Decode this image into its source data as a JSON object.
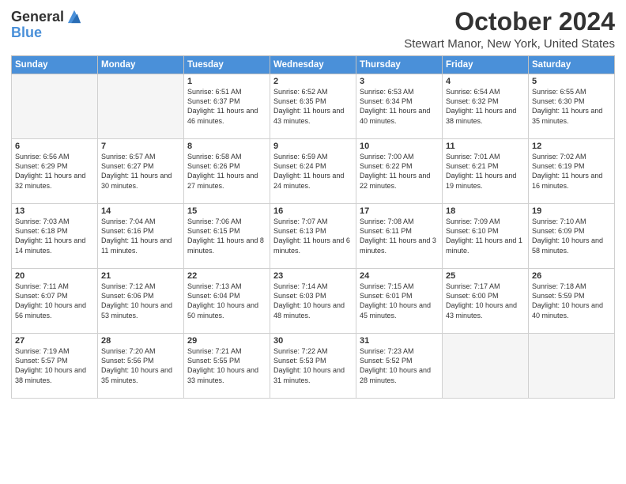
{
  "header": {
    "logo_general": "General",
    "logo_blue": "Blue",
    "month": "October 2024",
    "location": "Stewart Manor, New York, United States"
  },
  "days_of_week": [
    "Sunday",
    "Monday",
    "Tuesday",
    "Wednesday",
    "Thursday",
    "Friday",
    "Saturday"
  ],
  "weeks": [
    [
      {
        "day": "",
        "empty": true
      },
      {
        "day": "",
        "empty": true
      },
      {
        "day": "1",
        "sunrise": "Sunrise: 6:51 AM",
        "sunset": "Sunset: 6:37 PM",
        "daylight": "Daylight: 11 hours and 46 minutes."
      },
      {
        "day": "2",
        "sunrise": "Sunrise: 6:52 AM",
        "sunset": "Sunset: 6:35 PM",
        "daylight": "Daylight: 11 hours and 43 minutes."
      },
      {
        "day": "3",
        "sunrise": "Sunrise: 6:53 AM",
        "sunset": "Sunset: 6:34 PM",
        "daylight": "Daylight: 11 hours and 40 minutes."
      },
      {
        "day": "4",
        "sunrise": "Sunrise: 6:54 AM",
        "sunset": "Sunset: 6:32 PM",
        "daylight": "Daylight: 11 hours and 38 minutes."
      },
      {
        "day": "5",
        "sunrise": "Sunrise: 6:55 AM",
        "sunset": "Sunset: 6:30 PM",
        "daylight": "Daylight: 11 hours and 35 minutes."
      }
    ],
    [
      {
        "day": "6",
        "sunrise": "Sunrise: 6:56 AM",
        "sunset": "Sunset: 6:29 PM",
        "daylight": "Daylight: 11 hours and 32 minutes."
      },
      {
        "day": "7",
        "sunrise": "Sunrise: 6:57 AM",
        "sunset": "Sunset: 6:27 PM",
        "daylight": "Daylight: 11 hours and 30 minutes."
      },
      {
        "day": "8",
        "sunrise": "Sunrise: 6:58 AM",
        "sunset": "Sunset: 6:26 PM",
        "daylight": "Daylight: 11 hours and 27 minutes."
      },
      {
        "day": "9",
        "sunrise": "Sunrise: 6:59 AM",
        "sunset": "Sunset: 6:24 PM",
        "daylight": "Daylight: 11 hours and 24 minutes."
      },
      {
        "day": "10",
        "sunrise": "Sunrise: 7:00 AM",
        "sunset": "Sunset: 6:22 PM",
        "daylight": "Daylight: 11 hours and 22 minutes."
      },
      {
        "day": "11",
        "sunrise": "Sunrise: 7:01 AM",
        "sunset": "Sunset: 6:21 PM",
        "daylight": "Daylight: 11 hours and 19 minutes."
      },
      {
        "day": "12",
        "sunrise": "Sunrise: 7:02 AM",
        "sunset": "Sunset: 6:19 PM",
        "daylight": "Daylight: 11 hours and 16 minutes."
      }
    ],
    [
      {
        "day": "13",
        "sunrise": "Sunrise: 7:03 AM",
        "sunset": "Sunset: 6:18 PM",
        "daylight": "Daylight: 11 hours and 14 minutes."
      },
      {
        "day": "14",
        "sunrise": "Sunrise: 7:04 AM",
        "sunset": "Sunset: 6:16 PM",
        "daylight": "Daylight: 11 hours and 11 minutes."
      },
      {
        "day": "15",
        "sunrise": "Sunrise: 7:06 AM",
        "sunset": "Sunset: 6:15 PM",
        "daylight": "Daylight: 11 hours and 8 minutes."
      },
      {
        "day": "16",
        "sunrise": "Sunrise: 7:07 AM",
        "sunset": "Sunset: 6:13 PM",
        "daylight": "Daylight: 11 hours and 6 minutes."
      },
      {
        "day": "17",
        "sunrise": "Sunrise: 7:08 AM",
        "sunset": "Sunset: 6:11 PM",
        "daylight": "Daylight: 11 hours and 3 minutes."
      },
      {
        "day": "18",
        "sunrise": "Sunrise: 7:09 AM",
        "sunset": "Sunset: 6:10 PM",
        "daylight": "Daylight: 11 hours and 1 minute."
      },
      {
        "day": "19",
        "sunrise": "Sunrise: 7:10 AM",
        "sunset": "Sunset: 6:09 PM",
        "daylight": "Daylight: 10 hours and 58 minutes."
      }
    ],
    [
      {
        "day": "20",
        "sunrise": "Sunrise: 7:11 AM",
        "sunset": "Sunset: 6:07 PM",
        "daylight": "Daylight: 10 hours and 56 minutes."
      },
      {
        "day": "21",
        "sunrise": "Sunrise: 7:12 AM",
        "sunset": "Sunset: 6:06 PM",
        "daylight": "Daylight: 10 hours and 53 minutes."
      },
      {
        "day": "22",
        "sunrise": "Sunrise: 7:13 AM",
        "sunset": "Sunset: 6:04 PM",
        "daylight": "Daylight: 10 hours and 50 minutes."
      },
      {
        "day": "23",
        "sunrise": "Sunrise: 7:14 AM",
        "sunset": "Sunset: 6:03 PM",
        "daylight": "Daylight: 10 hours and 48 minutes."
      },
      {
        "day": "24",
        "sunrise": "Sunrise: 7:15 AM",
        "sunset": "Sunset: 6:01 PM",
        "daylight": "Daylight: 10 hours and 45 minutes."
      },
      {
        "day": "25",
        "sunrise": "Sunrise: 7:17 AM",
        "sunset": "Sunset: 6:00 PM",
        "daylight": "Daylight: 10 hours and 43 minutes."
      },
      {
        "day": "26",
        "sunrise": "Sunrise: 7:18 AM",
        "sunset": "Sunset: 5:59 PM",
        "daylight": "Daylight: 10 hours and 40 minutes."
      }
    ],
    [
      {
        "day": "27",
        "sunrise": "Sunrise: 7:19 AM",
        "sunset": "Sunset: 5:57 PM",
        "daylight": "Daylight: 10 hours and 38 minutes."
      },
      {
        "day": "28",
        "sunrise": "Sunrise: 7:20 AM",
        "sunset": "Sunset: 5:56 PM",
        "daylight": "Daylight: 10 hours and 35 minutes."
      },
      {
        "day": "29",
        "sunrise": "Sunrise: 7:21 AM",
        "sunset": "Sunset: 5:55 PM",
        "daylight": "Daylight: 10 hours and 33 minutes."
      },
      {
        "day": "30",
        "sunrise": "Sunrise: 7:22 AM",
        "sunset": "Sunset: 5:53 PM",
        "daylight": "Daylight: 10 hours and 31 minutes."
      },
      {
        "day": "31",
        "sunrise": "Sunrise: 7:23 AM",
        "sunset": "Sunset: 5:52 PM",
        "daylight": "Daylight: 10 hours and 28 minutes."
      },
      {
        "day": "",
        "empty": true
      },
      {
        "day": "",
        "empty": true
      }
    ]
  ]
}
